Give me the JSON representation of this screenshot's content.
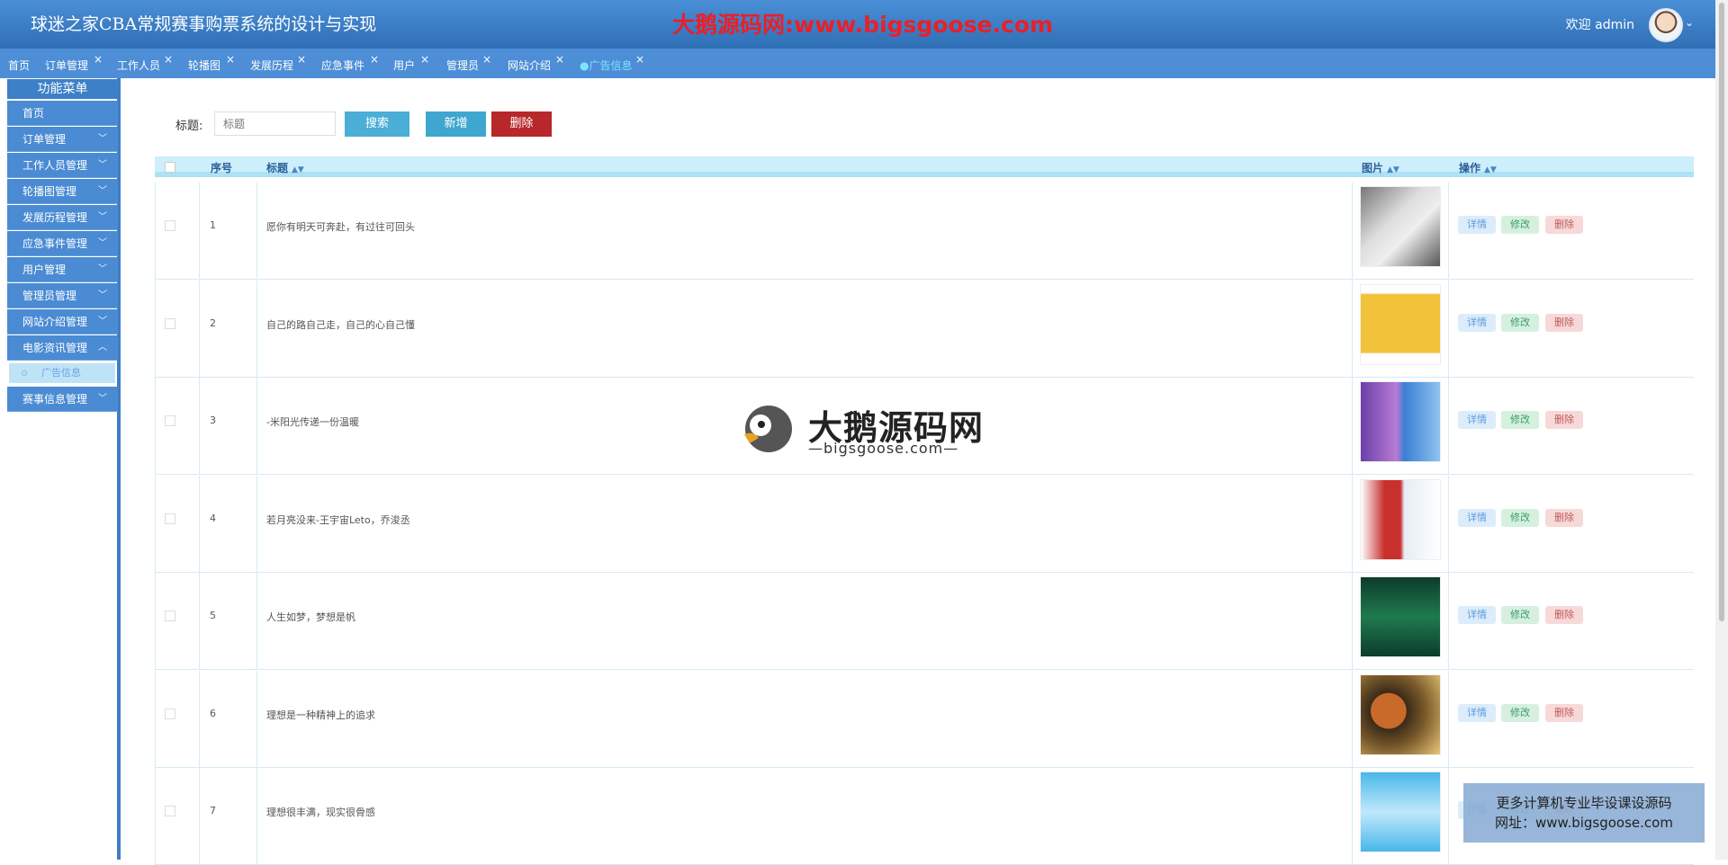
{
  "header": {
    "app_title": "球迷之家CBA常规赛事购票系统的设计与实现",
    "watermark_text": "大鹅源码网:www.bigsgoose.com",
    "welcome": "欢迎 admin"
  },
  "tabs": [
    {
      "label": "首页",
      "closable": false
    },
    {
      "label": "订单管理",
      "closable": true
    },
    {
      "label": "工作人员",
      "closable": true
    },
    {
      "label": "轮播图",
      "closable": true
    },
    {
      "label": "发展历程",
      "closable": true
    },
    {
      "label": "应急事件",
      "closable": true
    },
    {
      "label": "用户",
      "closable": true
    },
    {
      "label": "管理员",
      "closable": true
    },
    {
      "label": "网站介绍",
      "closable": true
    },
    {
      "label": "●广告信息",
      "closable": true,
      "active": true
    }
  ],
  "sidebar": {
    "heading": "功能菜单",
    "items": [
      {
        "label": "首页"
      },
      {
        "label": "订单管理"
      },
      {
        "label": "工作人员管理"
      },
      {
        "label": "轮播图管理"
      },
      {
        "label": "发展历程管理"
      },
      {
        "label": "应急事件管理"
      },
      {
        "label": "用户管理"
      },
      {
        "label": "管理员管理"
      },
      {
        "label": "网站介绍管理"
      },
      {
        "label": "电影资讯管理"
      },
      {
        "label": "赛事信息管理"
      }
    ],
    "sub_item": "广告信息"
  },
  "search": {
    "label": "标题:",
    "placeholder": "标题",
    "search_button": "搜索",
    "add_button": "新增",
    "delete_button": "删除"
  },
  "table": {
    "columns": [
      "序号",
      "标题",
      "图片",
      "操作"
    ],
    "rows": [
      {
        "num": "1",
        "title": "愿你有明天可奔赴，有过往可回头"
      },
      {
        "num": "2",
        "title": "自己的路自己走，自己的心自己懂"
      },
      {
        "num": "3",
        "title": "-米阳光传递一份温暖"
      },
      {
        "num": "4",
        "title": "若月亮没来-王宇宙Leto，乔浚丞"
      },
      {
        "num": "5",
        "title": "人生如梦，梦想是帆"
      },
      {
        "num": "6",
        "title": "理想是一种精神上的追求"
      },
      {
        "num": "7",
        "title": "理想很丰满，现实很骨感"
      }
    ],
    "actions": {
      "detail": "详情",
      "edit": "修改",
      "delete": "删除"
    }
  },
  "watermark": {
    "big": "大鹅源码网",
    "small": "—bigsgoose.com—"
  },
  "adbox": {
    "line1": "更多计算机专业毕设课设源码",
    "line2": "网址：www.bigsgoose.com"
  }
}
